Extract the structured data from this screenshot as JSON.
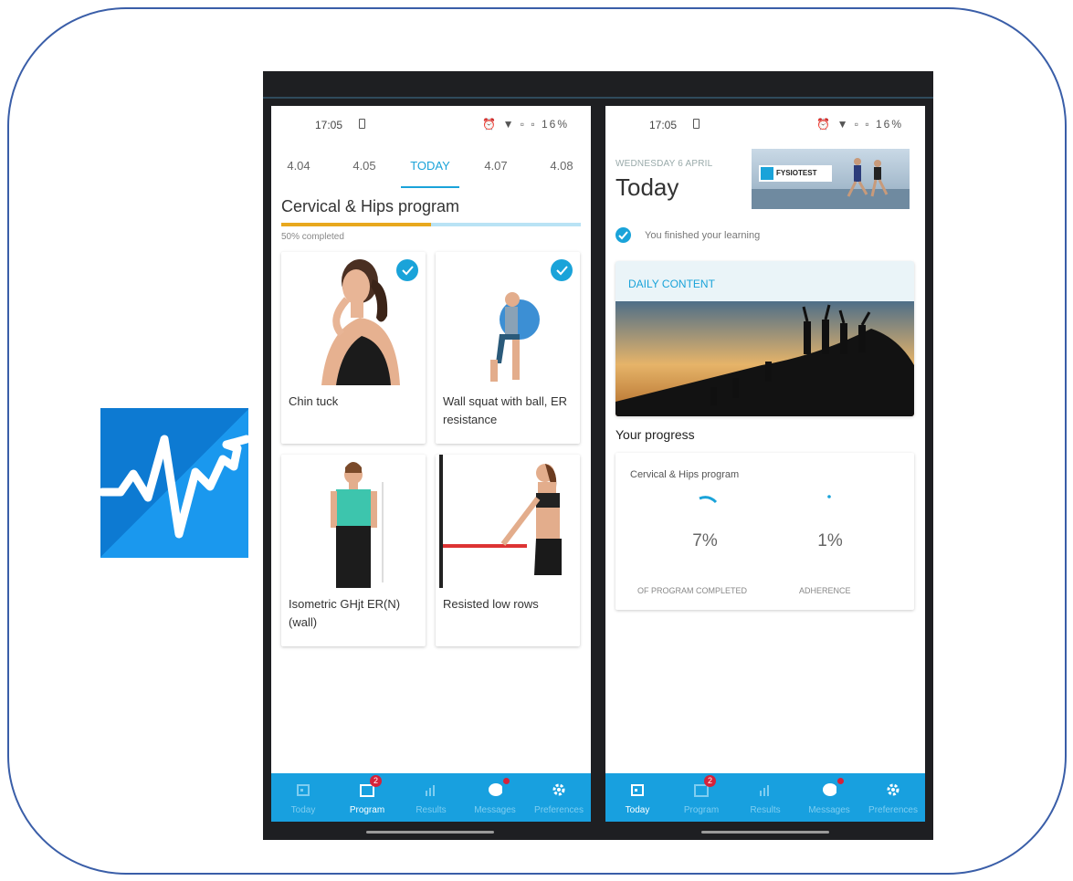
{
  "colors": {
    "accent": "#1aa3d9",
    "nav_bg": "#18a0df",
    "progress_fill": "#e8a81e",
    "badge": "#d5223a",
    "frame_border": "#3a5ea8"
  },
  "app_icon": {
    "icon": "heartbeat-chart-icon"
  },
  "left_screen": {
    "status": {
      "time": "17:05",
      "battery": "16%"
    },
    "date_tabs": [
      {
        "label": "4.04",
        "active": false
      },
      {
        "label": "4.05",
        "active": false
      },
      {
        "label": "TODAY",
        "active": true
      },
      {
        "label": "4.07",
        "active": false
      },
      {
        "label": "4.08",
        "active": false
      }
    ],
    "program": {
      "title": "Cervical & Hips program",
      "progress_fraction": 0.5,
      "progress_text": "50% completed"
    },
    "exercises": [
      {
        "label": "Chin  tuck",
        "completed": true
      },
      {
        "label": "Wall squat with ball, ER resistance",
        "completed": true
      },
      {
        "label": "Isometric GHjt ER(N) (wall)",
        "completed": false
      },
      {
        "label": "Resisted low rows",
        "completed": false
      }
    ],
    "nav": [
      {
        "label": "Today",
        "icon": "calendar-icon",
        "active": false
      },
      {
        "label": "Program",
        "icon": "program-calendar-icon",
        "active": true,
        "badge": "2"
      },
      {
        "label": "Results",
        "icon": "bar-chart-icon",
        "active": false
      },
      {
        "label": "Messages",
        "icon": "chat-bubble-icon",
        "active": false,
        "dot": true
      },
      {
        "label": "Preferences",
        "icon": "gear-icon",
        "active": false
      }
    ]
  },
  "right_screen": {
    "status": {
      "time": "17:05",
      "battery": "16%"
    },
    "weekday": "WEDNESDAY 6 APRIL",
    "title": "Today",
    "banner_brand": "FYSIOTEST",
    "learning_text": "You finished your learning",
    "daily_content_label": "DAILY CONTENT",
    "progress_heading": "Your progress",
    "progress_card": {
      "program_name": "Cervical & Hips program",
      "completed_pct": "7%",
      "completed_caption": "OF PROGRAM COMPLETED",
      "adherence_pct": "1%",
      "adherence_caption": "ADHERENCE"
    },
    "nav": [
      {
        "label": "Today",
        "icon": "calendar-icon",
        "active": true
      },
      {
        "label": "Program",
        "icon": "program-calendar-icon",
        "active": false,
        "badge": "2"
      },
      {
        "label": "Results",
        "icon": "bar-chart-icon",
        "active": false
      },
      {
        "label": "Messages",
        "icon": "chat-bubble-icon",
        "active": false,
        "dot": true
      },
      {
        "label": "Preferences",
        "icon": "gear-icon",
        "active": false
      }
    ]
  }
}
